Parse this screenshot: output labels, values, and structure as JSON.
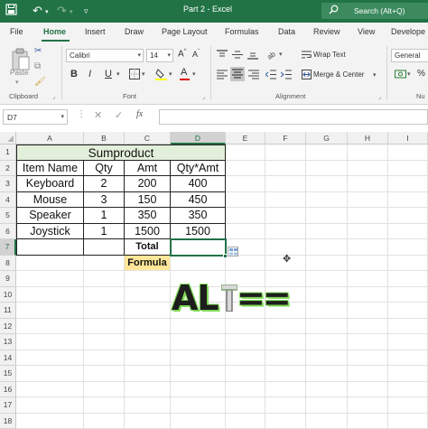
{
  "titlebar": {
    "title": "Part 2  -  Excel",
    "search": "Search (Alt+Q)"
  },
  "tabs": [
    "File",
    "Home",
    "Insert",
    "Draw",
    "Page Layout",
    "Formulas",
    "Data",
    "Review",
    "View",
    "Develope"
  ],
  "ribbon": {
    "paste_label": "Paste",
    "clipboard_label": "Clipboard",
    "font_name": "Calibri",
    "font_size": "14",
    "font_label": "Font",
    "bold": "B",
    "italic": "I",
    "underline": "U",
    "wrap_text": "Wrap Text",
    "merge_center": "Merge & Center",
    "alignment_label": "Alignment",
    "number_format": "General",
    "number_label": "Nu"
  },
  "formula_bar": {
    "name_box": "D7",
    "fx": "fx",
    "content": ""
  },
  "grid": {
    "columns": [
      "A",
      "B",
      "C",
      "D",
      "E",
      "F",
      "G",
      "H",
      "I"
    ],
    "rows": [
      "1",
      "2",
      "3",
      "4",
      "5",
      "6",
      "7",
      "8",
      "9",
      "10",
      "11",
      "12",
      "13",
      "14",
      "15",
      "16",
      "17",
      "18"
    ],
    "selected_cell": "D7",
    "title": "Sumproduct",
    "headers": [
      "Item Name",
      "Qty",
      "Amt",
      "Qty*Amt"
    ],
    "data": [
      [
        "Keyboard",
        "2",
        "200",
        "400"
      ],
      [
        "Mouse",
        "3",
        "150",
        "450"
      ],
      [
        "Speaker",
        "1",
        "350",
        "350"
      ],
      [
        "Joystick",
        "1",
        "1500",
        "1500"
      ]
    ],
    "total_label": "Total",
    "formula_label": "Formula"
  },
  "overlay": {
    "shortcut_alt": "AL",
    "shortcut_eq": "=="
  },
  "colors": {
    "excel_green": "#217346",
    "title_fill": "#e2efda",
    "formula_fill": "#ffe699"
  }
}
